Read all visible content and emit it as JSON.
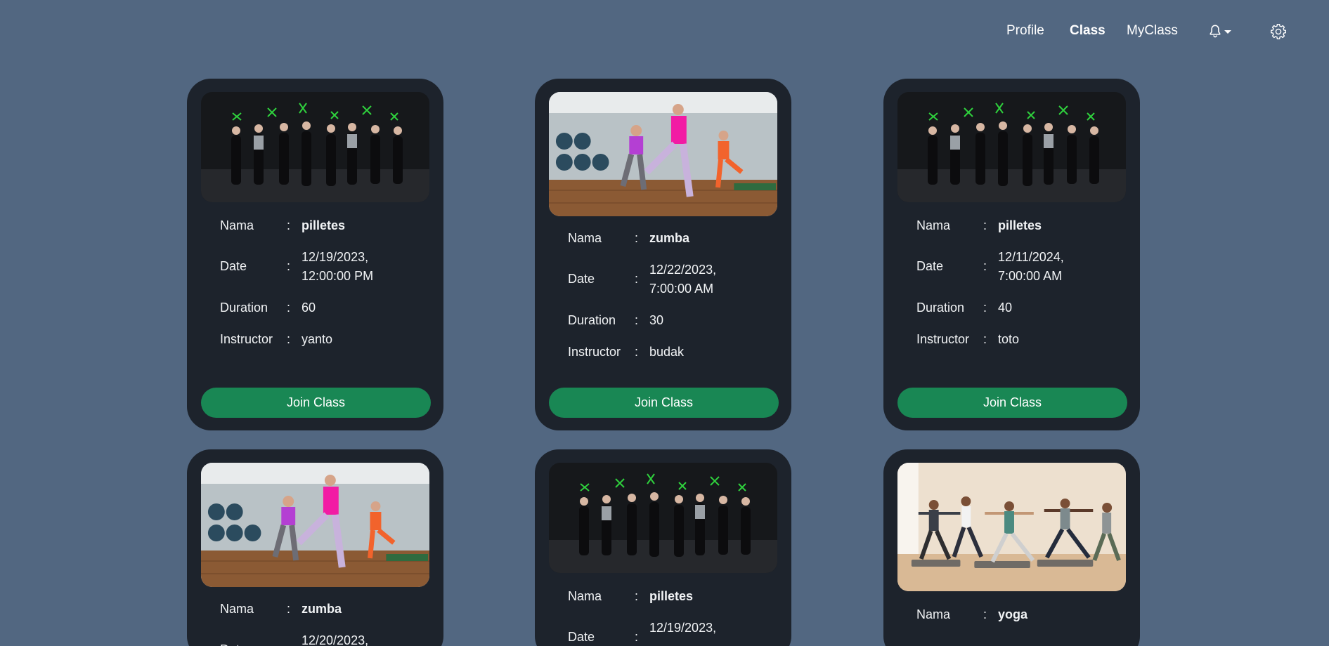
{
  "nav": {
    "profile": "Profile",
    "class": "Class",
    "myclass": "MyClass"
  },
  "labels": {
    "nama": "Nama",
    "date": "Date",
    "duration": "Duration",
    "instructor": "Instructor",
    "colon": ":",
    "join": "Join Class"
  },
  "colors": {
    "background": "#526781",
    "card": "#1d232c",
    "join_button": "#198754"
  },
  "cards": [
    {
      "image": "pilates-group-dance-photo",
      "nama": "pilletes",
      "date_line1": "12/19/2023,",
      "date_line2": "12:00:00 PM",
      "duration": "60",
      "instructor": "yanto"
    },
    {
      "image": "zumba-studio-dance-photo",
      "nama": "zumba",
      "date_line1": "12/22/2023,",
      "date_line2": "7:00:00 AM",
      "duration": "30",
      "instructor": "budak"
    },
    {
      "image": "pilates-group-dance-photo",
      "nama": "pilletes",
      "date_line1": "12/11/2024,",
      "date_line2": "7:00:00 AM",
      "duration": "40",
      "instructor": "toto"
    },
    {
      "image": "zumba-studio-dance-photo",
      "nama": "zumba",
      "date_line1": "12/20/2023,"
    },
    {
      "image": "pilates-group-dance-photo",
      "nama": "pilletes",
      "date_line1": "12/19/2023,"
    },
    {
      "image": "yoga-class-photo",
      "nama": "yoga"
    }
  ]
}
